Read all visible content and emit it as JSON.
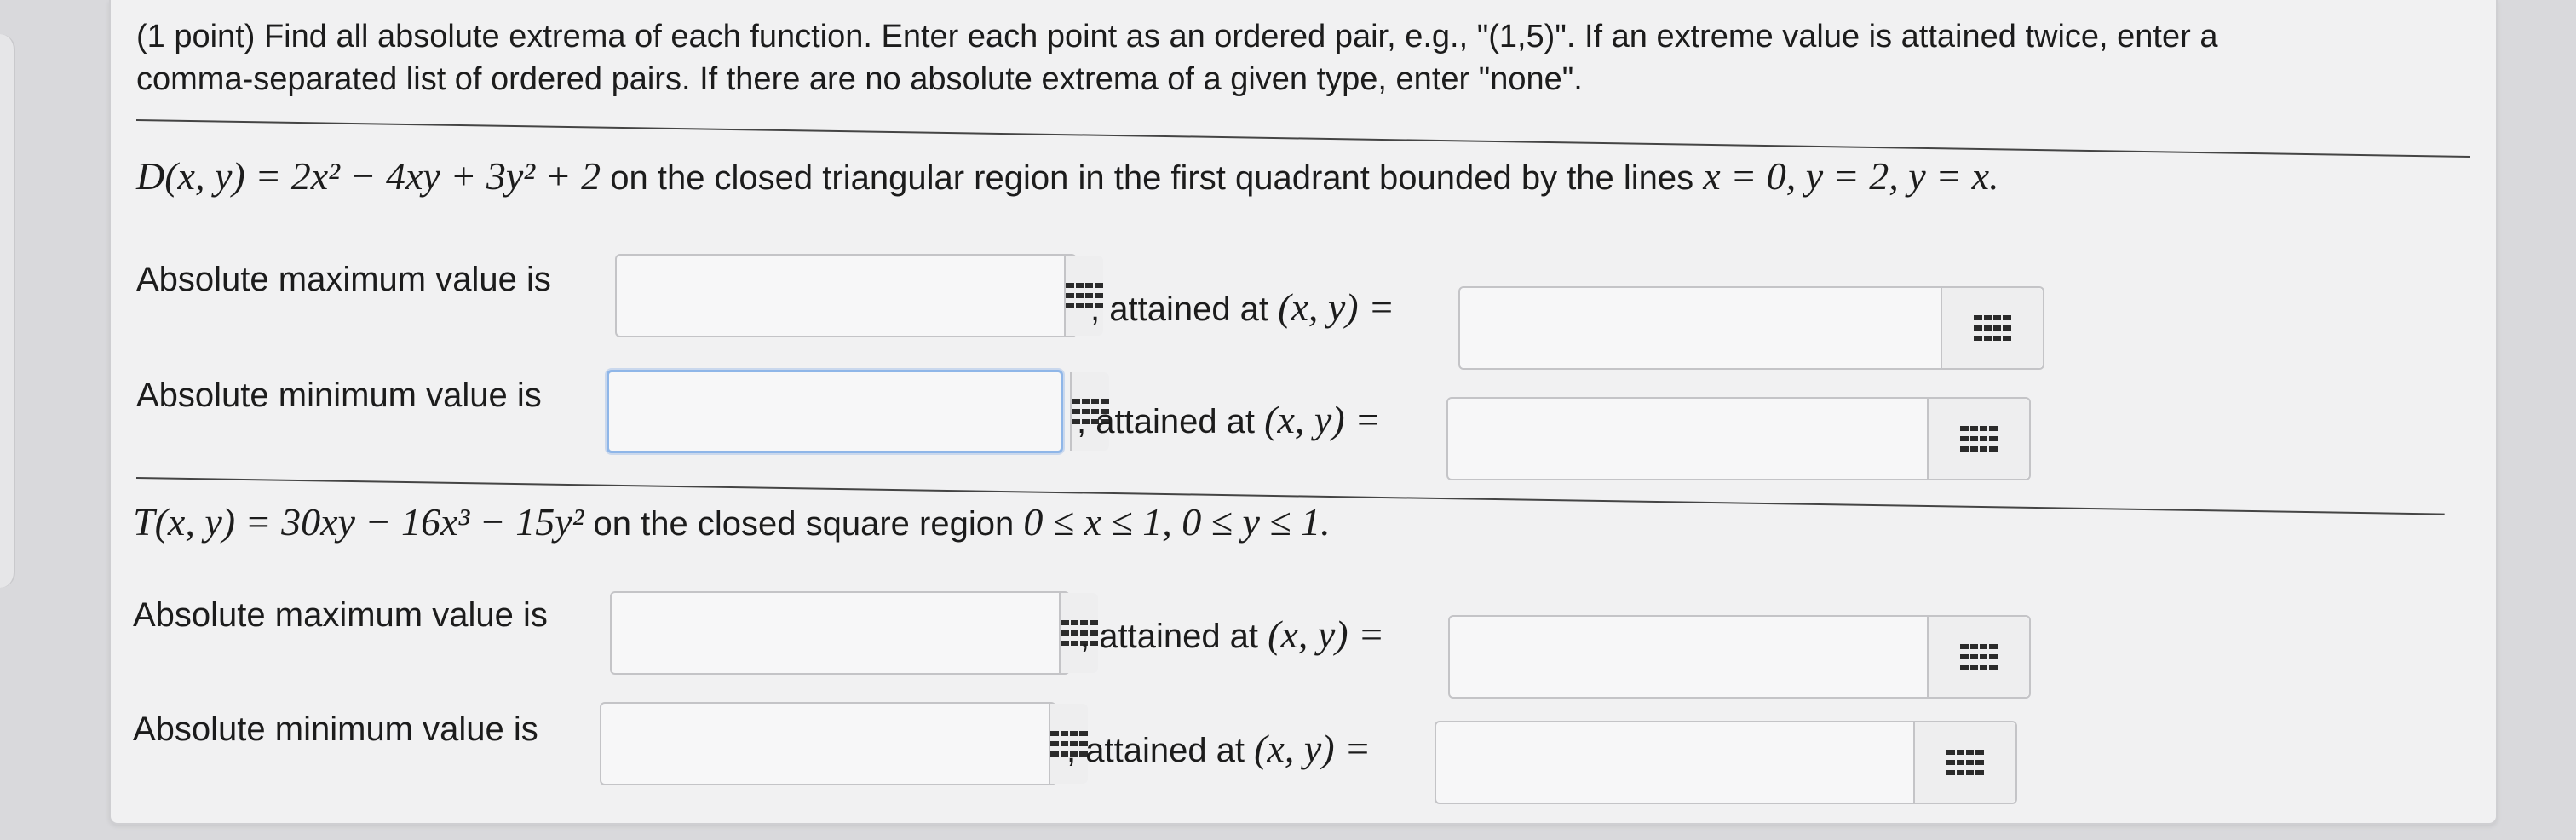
{
  "intro": {
    "line1": "(1 point) Find all absolute extrema of each function. Enter each point as an ordered pair, e.g., \"(1,5)\". If an extreme value is attained twice, enter a",
    "line2": "comma-separated list of ordered pairs. If there are no absolute extrema of a given type, enter \"none\"."
  },
  "problem1": {
    "function": "D(x, y) = 2x² − 4xy + 3y² + 2",
    "description": " on the closed triangular region in the first quadrant bounded by the lines ",
    "lines": "x = 0, y = 2, y = x."
  },
  "problem2": {
    "function": "T(x, y) = 30xy − 16x³ − 15y²",
    "description": " on the closed square region ",
    "region": "0 ≤ x ≤ 1, 0 ≤ y ≤ 1."
  },
  "labels": {
    "abs_max": "Absolute maximum value is",
    "abs_min": "Absolute minimum value is",
    "attained_prefix": ", attained at ",
    "attained_math": "(x, y) ="
  },
  "fields": {
    "p1_max_value": "",
    "p1_max_point": "",
    "p1_min_value": "",
    "p1_min_point": "",
    "p2_max_value": "",
    "p2_max_point": "",
    "p2_min_value": "",
    "p2_min_point": ""
  },
  "icons": {
    "grid_button": "grid-icon"
  }
}
